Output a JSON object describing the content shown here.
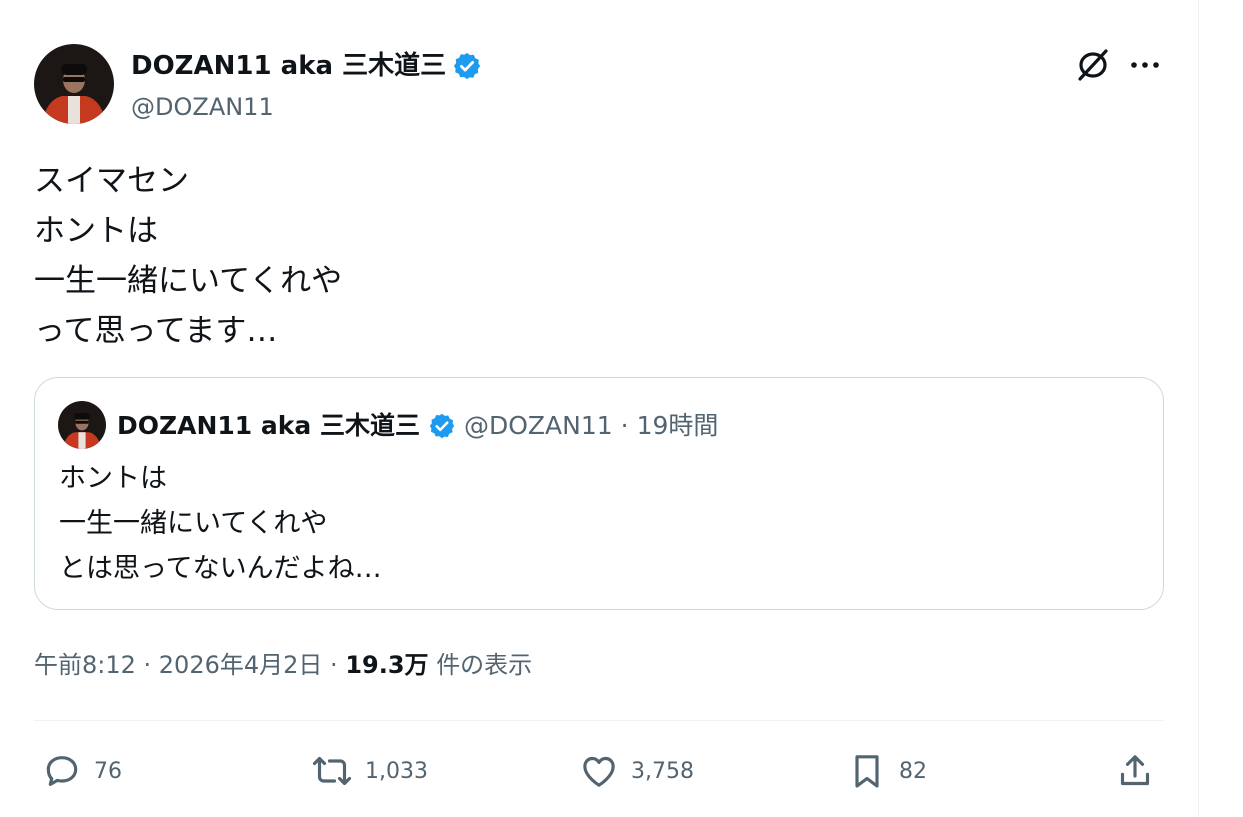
{
  "tweet": {
    "author_name": "DOZAN11 aka 三木道三",
    "handle": "@DOZAN11",
    "text": "スイマセン\nホントは\n一生一緒にいてくれや\nって思ってます…",
    "timestamp": "午前8:12 · 2026年4月2日",
    "meta_separator": "·",
    "views_count": "19.3万",
    "views_label": "件の表示"
  },
  "quoted": {
    "author_name": "DOZAN11 aka 三木道三",
    "handle": "@DOZAN11",
    "dot": "·",
    "time": "19時間",
    "text": "ホントは\n一生一緒にいてくれや\nとは思ってないんだよね…"
  },
  "actions": {
    "replies": "76",
    "reposts": "1,033",
    "likes": "3,758",
    "bookmarks": "82"
  },
  "icons": {
    "verified": "verified-badge-icon",
    "grok": "grok-icon",
    "more": "more-icon",
    "reply": "reply-icon",
    "repost": "repost-icon",
    "like": "like-icon",
    "bookmark": "bookmark-icon",
    "share": "share-icon"
  },
  "colors": {
    "verified": "#1d9bf0",
    "secondary_text": "#536471",
    "primary_text": "#0f1419",
    "border": "#cfd9de"
  }
}
